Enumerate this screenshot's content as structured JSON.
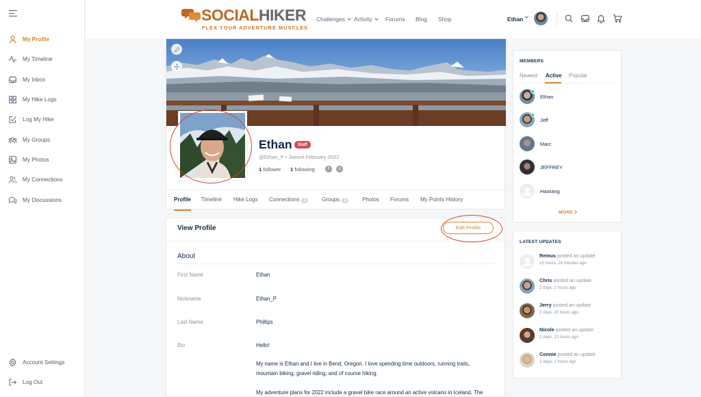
{
  "sidebar": {
    "items": [
      {
        "label": "My Profile",
        "icon": "user-icon"
      },
      {
        "label": "My Timeline",
        "icon": "activity-icon"
      },
      {
        "label": "My Inbox",
        "icon": "inbox-icon"
      },
      {
        "label": "My Hike Logs",
        "icon": "grid-icon"
      },
      {
        "label": "Log My Hike",
        "icon": "checkbox-edit-icon"
      },
      {
        "label": "My Groups",
        "icon": "groups-icon"
      },
      {
        "label": "My Photos",
        "icon": "image-icon"
      },
      {
        "label": "My Connections",
        "icon": "connections-icon"
      },
      {
        "label": "My Discussions",
        "icon": "discussions-icon"
      }
    ],
    "bottom": [
      {
        "label": "Account Settings",
        "icon": "gear-icon"
      },
      {
        "label": "Log Out",
        "icon": "logout-icon"
      }
    ]
  },
  "header": {
    "logo_main": "SOCIAL",
    "logo_accent": "HIKER",
    "logo_tagline": "FLEX YOUR ADVENTURE MUSCLES",
    "nav": [
      "Challenges",
      "Activity",
      "Forums",
      "Blog",
      "Shop"
    ],
    "user_name": "Ethan"
  },
  "profile": {
    "name": "Ethan",
    "badge": "Staff",
    "handle": "@Ethan_P • Joined February 2022",
    "followers_count": "1",
    "followers_label": "follower",
    "following_count": "1",
    "following_label": "following",
    "social": [
      "f",
      "ig"
    ],
    "tabs": [
      {
        "label": "Profile"
      },
      {
        "label": "Timeline"
      },
      {
        "label": "Hike Logs"
      },
      {
        "label": "Connections",
        "count": "1"
      },
      {
        "label": "Groups",
        "count": "2"
      },
      {
        "label": "Photos"
      },
      {
        "label": "Forums"
      },
      {
        "label": "My Points History"
      }
    ]
  },
  "view_profile": {
    "title": "View Profile",
    "edit_label": "Edit Profile",
    "section": "About",
    "fields": [
      {
        "label": "First Name",
        "value": "Ethan"
      },
      {
        "label": "Nickname",
        "value": "Ethan_P"
      },
      {
        "label": "Last Name",
        "value": "Phillips"
      },
      {
        "label": "Bio",
        "value": "Hello!"
      }
    ],
    "bio_p1": "My name is Ethan and I live in Bend, Oregon. I love spending time outdoors, running trails, mountain biking, gravel riding, and of course hiking.",
    "bio_p2": "My adventure plans for 2022 include a gravel bike race around an active volcano in Iceland, The"
  },
  "members": {
    "title": "MEMBERS",
    "tabs": [
      "Newest",
      "Active",
      "Popular"
    ],
    "list": [
      "Ethan",
      "Jeff",
      "Marc",
      "JEFFREY",
      "Haixiang"
    ],
    "more": "MORE"
  },
  "updates": {
    "title": "LATEST UPDATES",
    "action": "posted an update",
    "list": [
      {
        "name": "Remus",
        "time": "15 hours, 16 minutes ago"
      },
      {
        "name": "Chris",
        "time": "2 days, 2 hours ago"
      },
      {
        "name": "Jerry",
        "time": "2 days, 20 hours ago"
      },
      {
        "name": "Nicole",
        "time": "2 days, 23 hours ago"
      },
      {
        "name": "Connie",
        "time": "3 days, 2 hours ago"
      }
    ]
  },
  "colors": {
    "accent": "#d9822b",
    "staff_badge": "#d34e55",
    "annotation_circle": "#d9412b"
  }
}
